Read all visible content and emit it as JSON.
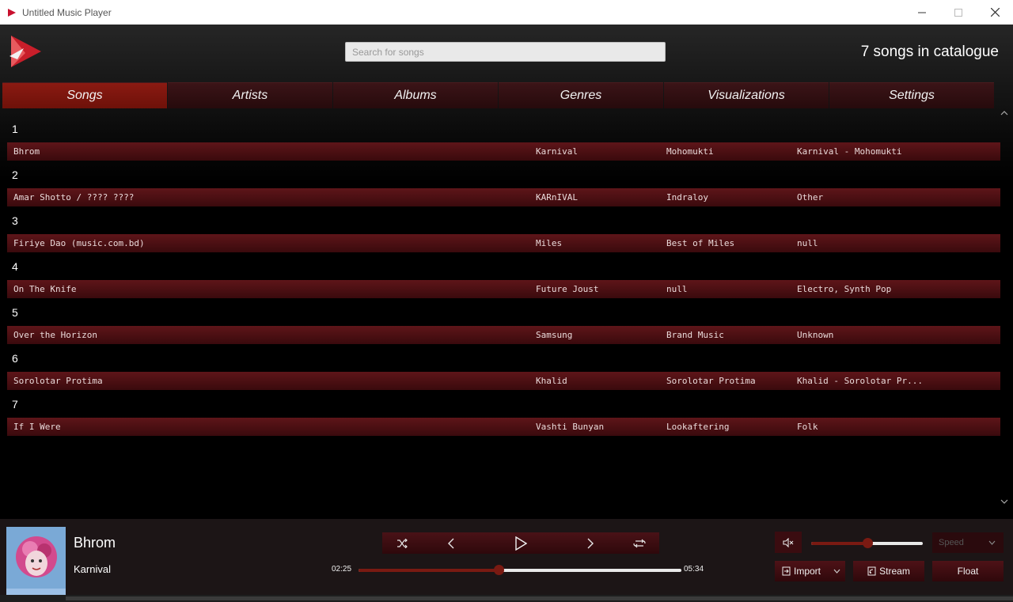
{
  "window": {
    "title": "Untitled Music Player",
    "min_icon": "minimize-icon",
    "max_icon": "maximize-icon",
    "close_icon": "close-icon"
  },
  "header": {
    "search_placeholder": "Search for songs",
    "catalogue_count": "7 songs in catalogue"
  },
  "tabs": [
    {
      "label": "Songs",
      "active": true
    },
    {
      "label": "Artists",
      "active": false
    },
    {
      "label": "Albums",
      "active": false
    },
    {
      "label": "Genres",
      "active": false
    },
    {
      "label": "Visualizations",
      "active": false
    },
    {
      "label": "Settings",
      "active": false
    }
  ],
  "songs": [
    {
      "num": "1",
      "title": "Bhrom",
      "artist": "Karnival",
      "album": "Mohomukti",
      "genre": "Karnival - Mohomukti"
    },
    {
      "num": "2",
      "title": "Amar Shotto / ???? ????",
      "artist": "KARnIVAL",
      "album": "Indraloy",
      "genre": "Other"
    },
    {
      "num": "3",
      "title": "Firiye Dao (music.com.bd)",
      "artist": "Miles",
      "album": "Best of Miles",
      "genre": "null"
    },
    {
      "num": "4",
      "title": "On The Knife",
      "artist": "Future Joust",
      "album": "null",
      "genre": "Electro, Synth Pop"
    },
    {
      "num": "5",
      "title": "Over the Horizon",
      "artist": "Samsung",
      "album": "Brand Music",
      "genre": "Unknown"
    },
    {
      "num": "6",
      "title": "Sorolotar Protima",
      "artist": "Khalid",
      "album": "Sorolotar Protima",
      "genre": "Khalid - Sorolotar Pr..."
    },
    {
      "num": "7",
      "title": "If I Were",
      "artist": "Vashti Bunyan",
      "album": "Lookaftering",
      "genre": "Folk"
    }
  ],
  "player": {
    "now_playing_title": "Bhrom",
    "now_playing_artist": "Karnival",
    "current_time": "02:25",
    "total_time": "05:34",
    "progress": 0.434,
    "volume": 0.5,
    "speed_placeholder": "Speed",
    "import_label": "Import",
    "stream_label": "Stream",
    "float_label": "Float"
  },
  "colors": {
    "accent": "#7a1a12",
    "tab_active": "#8a1a12",
    "row": "#4a0f13"
  }
}
